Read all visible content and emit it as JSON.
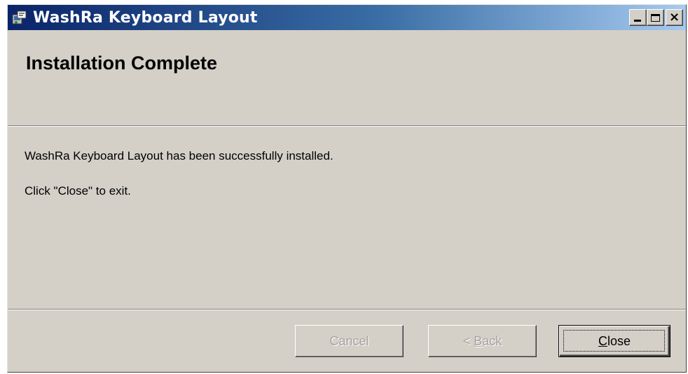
{
  "window": {
    "title": "WashRa Keyboard Layout",
    "app_icon": "installer-icon",
    "controls": [
      "minimize-icon",
      "maximize-icon",
      "close-icon"
    ]
  },
  "banner": {
    "title": "Installation Complete"
  },
  "body": {
    "line1": "WashRa Keyboard Layout has been successfully installed.",
    "line2": "Click \"Close\" to exit."
  },
  "buttons": {
    "cancel": {
      "label": "Cancel",
      "enabled": false
    },
    "back": {
      "prefix": "< ",
      "mnemonic": "B",
      "rest": "ack",
      "enabled": false
    },
    "close": {
      "mnemonic": "C",
      "rest": "lose",
      "enabled": true,
      "default": true
    }
  },
  "colors": {
    "title_gradient_start": "#0a246a",
    "title_gradient_end": "#a6caf0",
    "face": "#d4d0c8"
  }
}
